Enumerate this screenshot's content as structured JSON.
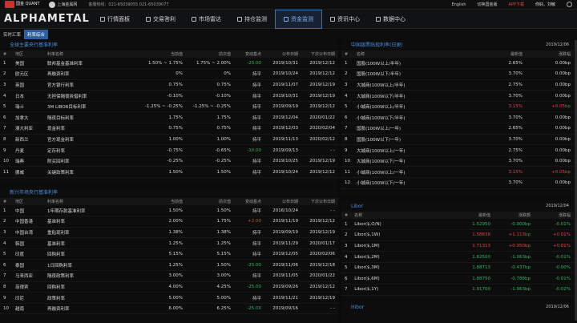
{
  "topbar": {
    "brand_q": "国金\nQUANT",
    "brand_sh": "上海金属网",
    "hotline": "客服热线：021-65039055 021-65039077",
    "lang": "English",
    "switch_site": "切换国金版",
    "app_download": "APP下载",
    "greeting": "你好。刘敏",
    "gear_icon": "gear-icon"
  },
  "nav": {
    "brand": "ALPHAMETAL",
    "items": [
      {
        "label": "行情面板",
        "icon": "monitor-icon"
      },
      {
        "label": "交易答利",
        "icon": "exchange-icon"
      },
      {
        "label": "市场雷达",
        "icon": "radar-icon"
      },
      {
        "label": "持仓监测",
        "icon": "house-icon"
      },
      {
        "label": "资金监测",
        "icon": "money-icon"
      },
      {
        "label": "资讯中心",
        "icon": "news-icon"
      },
      {
        "label": "数据中心",
        "icon": "data-icon"
      }
    ],
    "active_index": 4
  },
  "subtabs": [
    {
      "label": "实时汇率",
      "active": false
    },
    {
      "label": "利率综合",
      "active": true
    }
  ],
  "central_rates": {
    "title": "全球主要央行基准利率",
    "headers": [
      "#",
      "地区",
      "利率名称",
      "当前值",
      "前次值",
      "变动基点",
      "公布日期",
      "下次公布日期"
    ],
    "rows": [
      [
        "1",
        "美国",
        "联邦基金基准利率",
        "1.50% ~ 1.75%",
        "1.75% ~ 2.00%",
        "-25.00",
        "2019/10/31",
        "2019/12/12"
      ],
      [
        "2",
        "欧元区",
        "再融资利率",
        "0%",
        "0%",
        "持平",
        "2019/10/24",
        "2019/12/12"
      ],
      [
        "3",
        "英国",
        "官方银行利率",
        "0.75%",
        "0.75%",
        "持平",
        "2019/11/07",
        "2019/12/19"
      ],
      [
        "4",
        "日本",
        "无担保隔夜拆借利率",
        "-0.10%",
        "-0.10%",
        "持平",
        "2019/10/31",
        "2019/12/19"
      ],
      [
        "5",
        "瑞士",
        "3M LIBOR目标利率",
        "-1.25% ~ -0.25%",
        "-1.25% ~ -0.25%",
        "持平",
        "2019/09/19",
        "2019/12/12"
      ],
      [
        "6",
        "加拿大",
        "隔夜目标利率",
        "1.75%",
        "1.75%",
        "持平",
        "2019/12/04",
        "2020/01/22"
      ],
      [
        "7",
        "澳大利亚",
        "现金利率",
        "0.75%",
        "0.75%",
        "持平",
        "2019/12/03",
        "2020/02/04"
      ],
      [
        "8",
        "新西兰",
        "官方现金利率",
        "1.00%",
        "1.00%",
        "持平",
        "2019/11/13",
        "2020/02/12"
      ],
      [
        "9",
        "丹麦",
        "定存利率",
        "-0.75%",
        "-0.65%",
        "-10.00",
        "2019/09/13",
        "- -"
      ],
      [
        "10",
        "瑞典",
        "附买回利率",
        "-0.25%",
        "-0.25%",
        "持平",
        "2019/10/25",
        "2019/12/19"
      ],
      [
        "11",
        "挪威",
        "关键政策利率",
        "1.50%",
        "1.50%",
        "持平",
        "2019/10/24",
        "2019/12/12"
      ]
    ]
  },
  "emerging_rates": {
    "title": "新兴市场央行基准利率",
    "headers": [
      "#",
      "地区",
      "利率名称",
      "当前值",
      "前次值",
      "变动基点",
      "公布日期",
      "下次公布日期"
    ],
    "rows": [
      [
        "1",
        "中国",
        "1年期存款基准利率",
        "1.50%",
        "1.50%",
        "持平",
        "2016/10/24",
        "- -"
      ],
      [
        "2",
        "中国香港",
        "基准利率",
        "2.00%",
        "1.75%",
        "+2.00",
        "2019/11/19",
        "2019/12/12"
      ],
      [
        "3",
        "中国台湾",
        "重贴现利率",
        "1.38%",
        "1.38%",
        "持平",
        "2019/09/19",
        "2019/12/19"
      ],
      [
        "4",
        "韩国",
        "基准利率",
        "1.25%",
        "1.25%",
        "持平",
        "2019/11/29",
        "2020/01/17"
      ],
      [
        "5",
        "印度",
        "回购利率",
        "5.15%",
        "5.15%",
        "持平",
        "2019/12/05",
        "2020/02/06"
      ],
      [
        "6",
        "泰国",
        "1日回购利率",
        "1.25%",
        "1.50%",
        "-25.00",
        "2019/11/06",
        "2019/12/18"
      ],
      [
        "7",
        "马来西亚",
        "隔夜政策利率",
        "3.00%",
        "3.00%",
        "持平",
        "2019/11/05",
        "2020/01/22"
      ],
      [
        "8",
        "菲律宾",
        "回购利率",
        "4.00%",
        "4.25%",
        "-25.00",
        "2019/09/26",
        "2019/12/12"
      ],
      [
        "9",
        "印尼",
        "政策利率",
        "5.00%",
        "5.00%",
        "持平",
        "2019/11/21",
        "2019/12/19"
      ],
      [
        "10",
        "越南",
        "再融资利率",
        "6.00%",
        "6.25%",
        "-25.00",
        "2019/09/16",
        "- -"
      ]
    ]
  },
  "bill_rates": {
    "title": "中国银票贴现利率(日更)",
    "date": "2019/12/06",
    "headers": [
      "#",
      "名称",
      "最新值",
      "涨跌幅"
    ],
    "rows": [
      [
        "1",
        "国股(100W以上/半年)",
        "2.65%",
        "0.00bp"
      ],
      [
        "2",
        "国股(100W以下/半年)",
        "3.70%",
        "0.00bp"
      ],
      [
        "3",
        "大城商(100W以上/半年)",
        "2.75%",
        "0.00bp"
      ],
      [
        "4",
        "大城商(100W以下/半年)",
        "3.70%",
        "0.00bp"
      ],
      [
        "5",
        "小城商(100W以上/半年)",
        "3.15%",
        "+0.05bp"
      ],
      [
        "6",
        "小城商(100W以下/半年)",
        "3.70%",
        "0.00bp"
      ],
      [
        "7",
        "国股(100W以上/一年)",
        "2.65%",
        "0.00bp"
      ],
      [
        "8",
        "国股(100W以下/一年)",
        "3.70%",
        "0.00bp"
      ],
      [
        "9",
        "大城商(100W以上/一年)",
        "2.75%",
        "0.00bp"
      ],
      [
        "10",
        "大城商(100W以下/一年)",
        "3.70%",
        "0.00bp"
      ],
      [
        "11",
        "小城商(100W以上/一年)",
        "3.15%",
        "+0.05bp"
      ],
      [
        "12",
        "小城商(100W以下/一年)",
        "3.70%",
        "0.00bp"
      ]
    ]
  },
  "libor": {
    "title": "Libor",
    "date": "2019/12/04",
    "headers": [
      "#",
      "名称",
      "最新值",
      "涨跌额",
      "涨跌幅"
    ],
    "rows": [
      [
        "1",
        "Libor($,O/N)",
        "1.52950",
        "-0.900bp",
        "-0.01%"
      ],
      [
        "2",
        "Libor($,1W)",
        "1.58838",
        "+1.113bp",
        "+0.01%"
      ],
      [
        "3",
        "Libor($,1M)",
        "1.71313",
        "+0.950bp",
        "+0.01%"
      ],
      [
        "4",
        "Libor($,2M)",
        "1.82500",
        "-1.063bp",
        "-0.01%"
      ],
      [
        "5",
        "Libor($,3M)",
        "1.88713",
        "-0.437bp",
        "-0.00%"
      ],
      [
        "6",
        "Libor($,6M)",
        "1.88750",
        "-0.788bp",
        "-0.01%"
      ],
      [
        "7",
        "Libor($,1Y)",
        "1.91700",
        "-1.963bp",
        "-0.02%"
      ]
    ]
  },
  "hibor": {
    "title": "Hibor",
    "date": "2019/12/06"
  },
  "colors": {
    "accent": "#4c8fe0",
    "up": "#e04444",
    "down": "#2fb45a",
    "active_subtab": "#2c5f9e"
  }
}
